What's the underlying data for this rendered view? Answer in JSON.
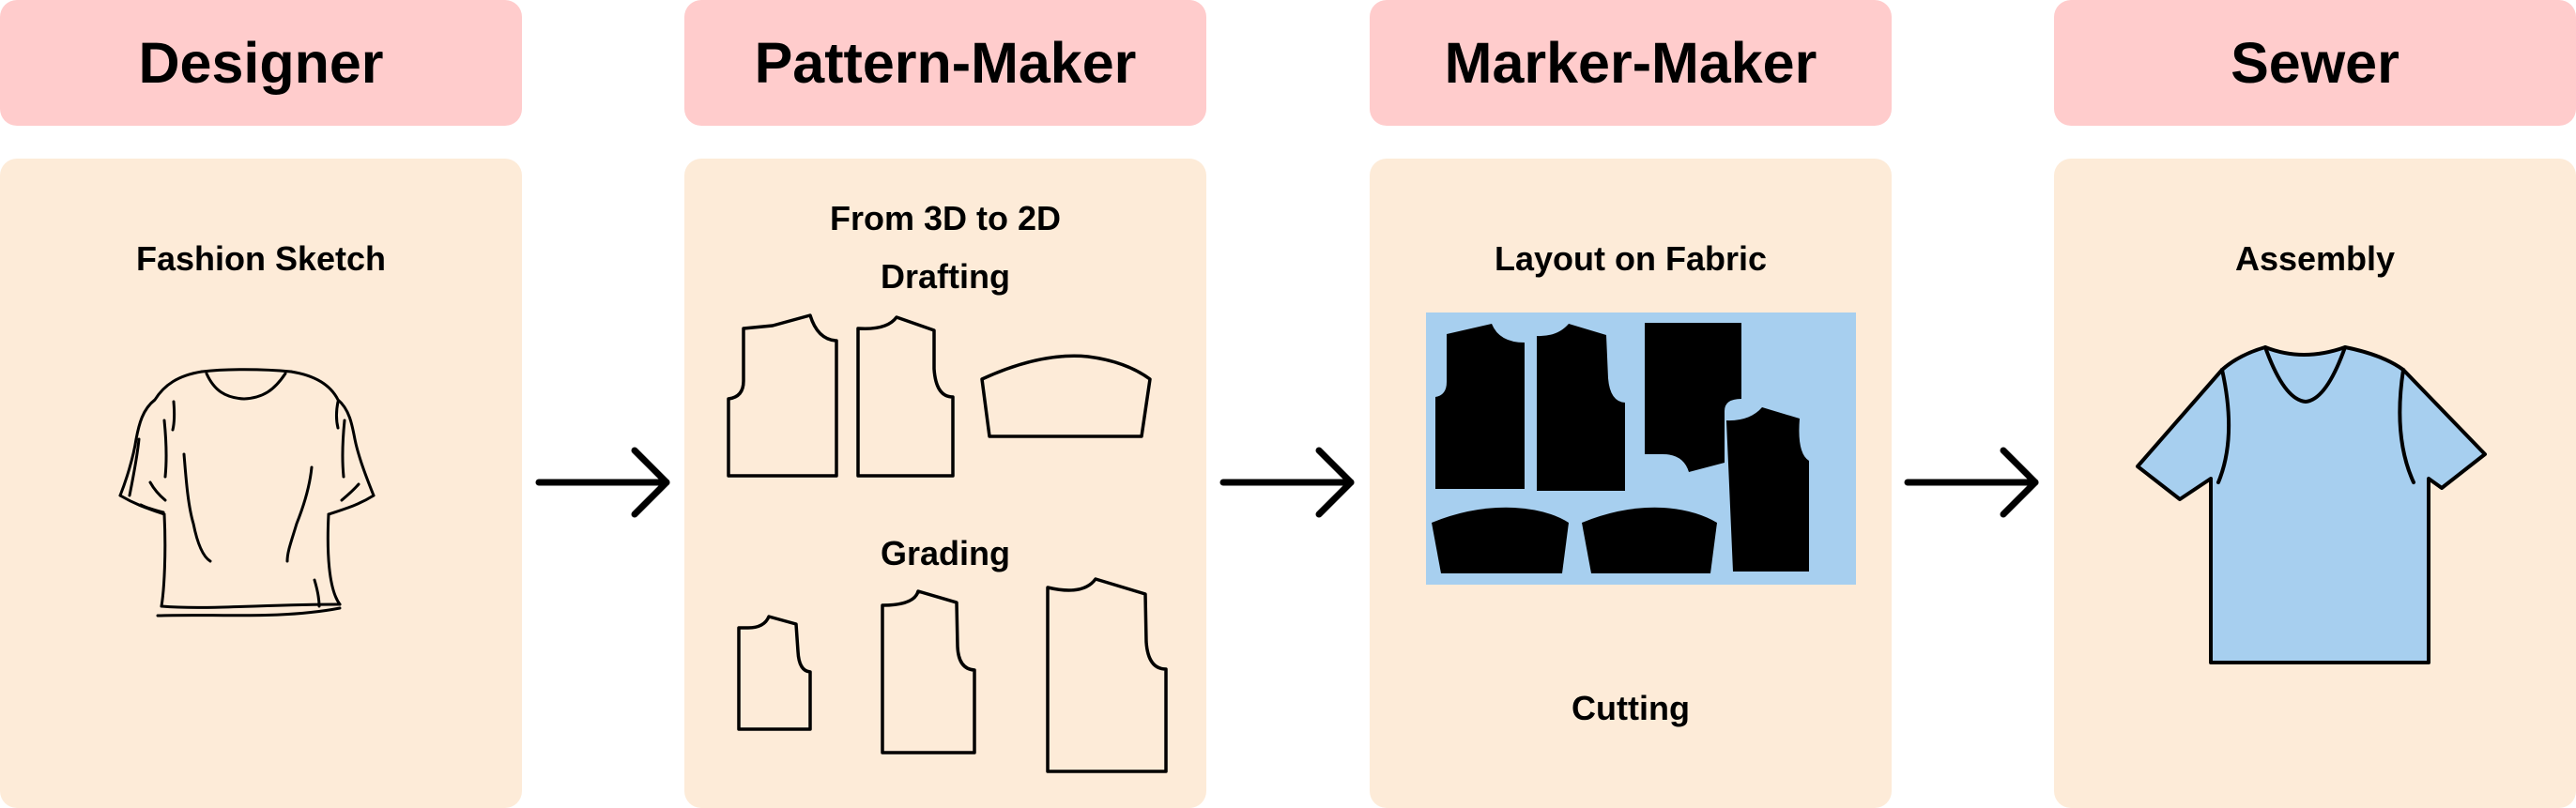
{
  "colors": {
    "header_bg": "#ffcccc",
    "panel_bg": "#fdebd8",
    "fabric": "#a7cfef",
    "shirt": "#a7cfef",
    "ink": "#000000"
  },
  "stages": [
    {
      "header": "Designer",
      "labels": [
        "Fashion Sketch"
      ]
    },
    {
      "header": "Pattern-Maker",
      "labels": [
        "From 3D to 2D",
        "Drafting",
        "Grading"
      ]
    },
    {
      "header": "Marker-Maker",
      "labels": [
        "Layout on Fabric",
        "Cutting"
      ]
    },
    {
      "header": "Sewer",
      "labels": [
        "Assembly"
      ]
    }
  ],
  "icons": {
    "sketch": "tshirt-sketch-icon",
    "arrow": "right-arrow-icon",
    "shirt": "tshirt-icon"
  }
}
